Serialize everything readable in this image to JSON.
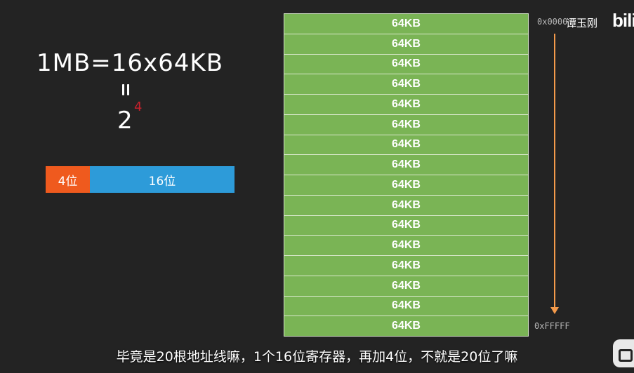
{
  "formula": {
    "text": "1MB=16x64KB",
    "power_base": "2",
    "power_exponent": "4"
  },
  "bits_bar": {
    "high_label": "4位",
    "low_label": "16位"
  },
  "memory": {
    "block_label": "64KB",
    "block_count": 16,
    "start_address": "0x0000",
    "end_address": "0xFFFFF"
  },
  "watermark": {
    "author": "谭玉刚",
    "logo": "bili"
  },
  "subtitle": "毕竟是20根地址线嘛，1个16位寄存器，再加4位，不就是20位了嘛",
  "colors": {
    "background": "#232323",
    "block_green": "#7ab455",
    "bits_orange": "#ef5a1e",
    "bits_blue": "#2d9bd9",
    "arrow_orange": "#f49a4b",
    "exponent_red": "#c8202c"
  }
}
